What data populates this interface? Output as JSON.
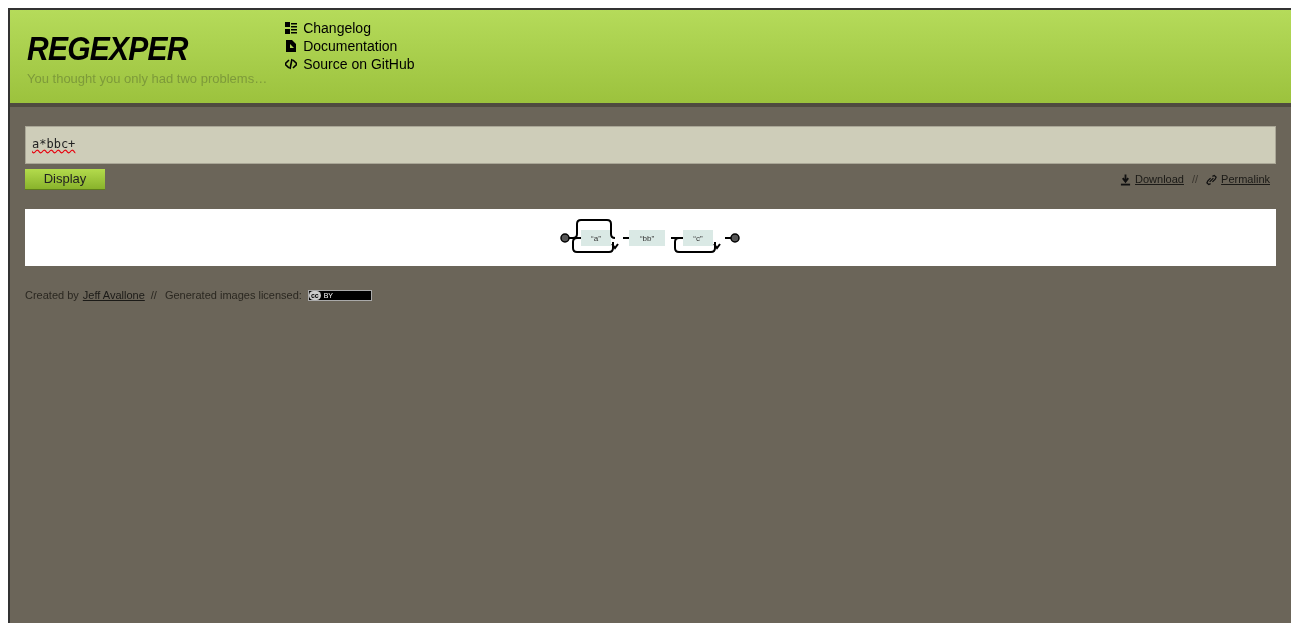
{
  "header": {
    "logo": "REGEXPER",
    "tagline": "You thought you only had two problems…",
    "nav": [
      {
        "kind": "changelog",
        "label": "Changelog"
      },
      {
        "kind": "documentation",
        "label": "Documentation"
      },
      {
        "kind": "source",
        "label": "Source on GitHub"
      }
    ]
  },
  "expression": {
    "value": "a*bbc+"
  },
  "display_button": "Display",
  "actions": [
    {
      "kind": "download",
      "label": "Download"
    },
    {
      "kind": "permalink",
      "label": "Permalink"
    }
  ],
  "action_separator": "//",
  "diagram": {
    "nodes": [
      {
        "label": "“a”",
        "kind": "zero_or_more"
      },
      {
        "label": "“bb”",
        "kind": "once"
      },
      {
        "label": "“c”",
        "kind": "one_or_more"
      }
    ]
  },
  "footer": {
    "created_by": "Created by",
    "author": "Jeff Avallone",
    "separator": "//",
    "license_text": "Generated images licensed:",
    "badge_left": "cc",
    "badge_right": "BY"
  }
}
